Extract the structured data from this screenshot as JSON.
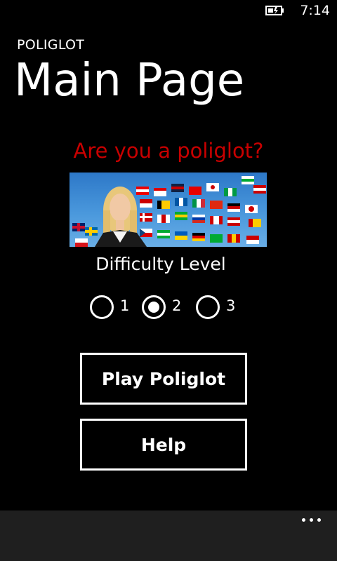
{
  "status_bar": {
    "time": "7:14",
    "battery_icon": "battery-charging-icon"
  },
  "header": {
    "app_title": "POLIGLOT",
    "page_title": "Main Page"
  },
  "main": {
    "question": "Are you a poliglot?",
    "question_color": "#c80000",
    "banner_image": "woman-with-world-flags-banner",
    "difficulty_label": "Difficulty Level",
    "difficulty_options": [
      {
        "label": "1",
        "selected": false
      },
      {
        "label": "2",
        "selected": true
      },
      {
        "label": "3",
        "selected": false
      }
    ],
    "play_button": "Play Poliglot",
    "help_button": "Help"
  },
  "app_bar": {
    "more_icon": "ellipsis-more-icon"
  }
}
